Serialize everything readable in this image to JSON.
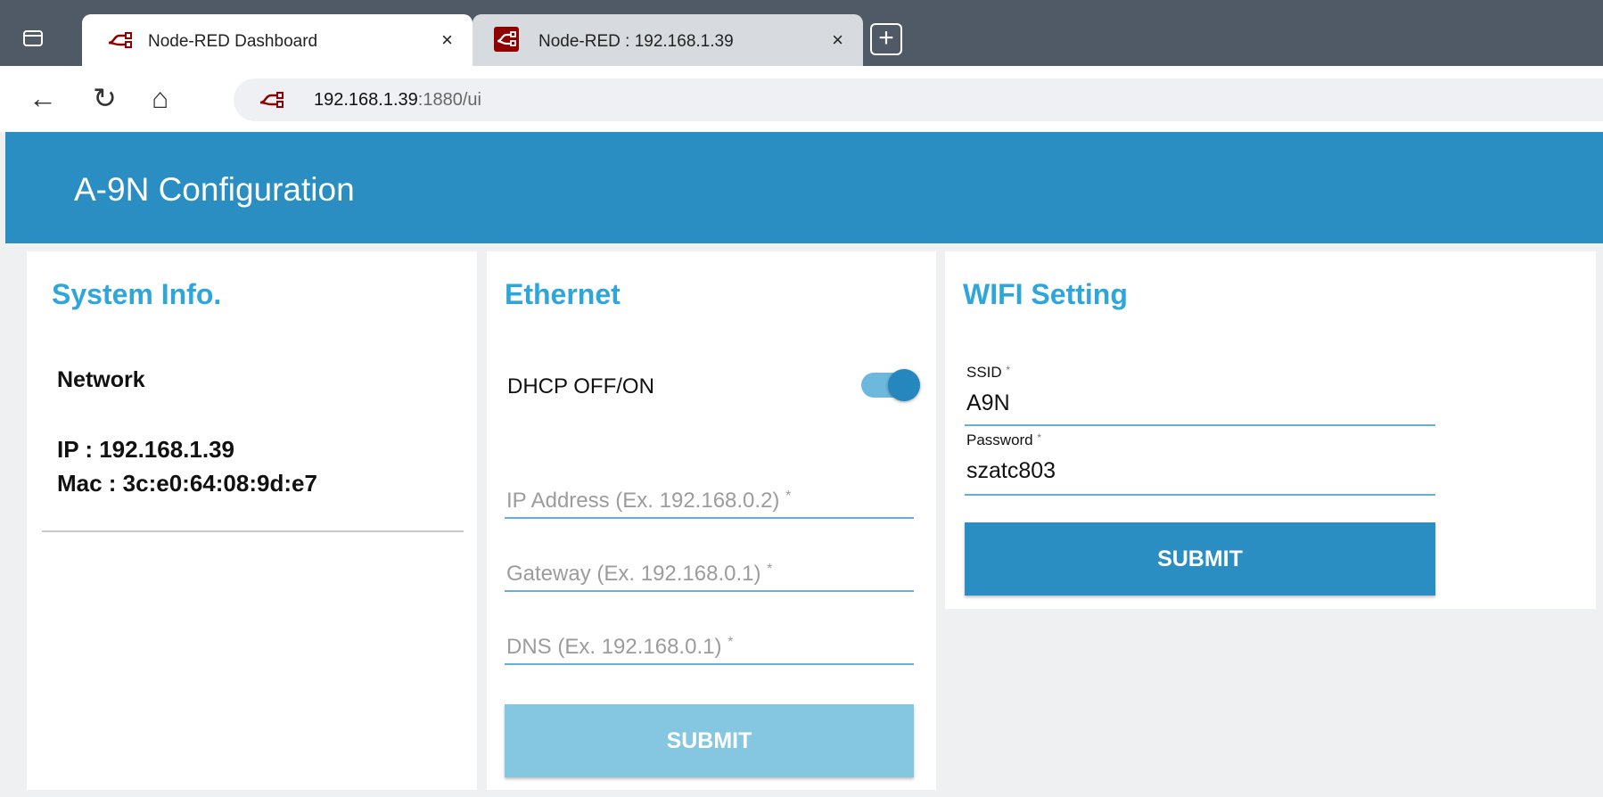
{
  "browser": {
    "tabs": [
      {
        "title": "Node-RED Dashboard",
        "active": true
      },
      {
        "title": "Node-RED : 192.168.1.39",
        "active": false
      }
    ],
    "tab_close_glyph": "×",
    "new_tab_glyph": "+",
    "nav": {
      "back_glyph": "←",
      "reload_glyph": "↻",
      "home_glyph": "⌂"
    },
    "url": {
      "host": "192.168.1.39",
      "rest": ":1880/ui"
    }
  },
  "dashboard": {
    "title": "A-9N Configuration",
    "accent_color": "#2b8ec3"
  },
  "system_info": {
    "title": "System Info.",
    "network_label": "Network",
    "ip_line": "IP :  192.168.1.39",
    "mac_line": "Mac :  3c:e0:64:08:9d:e7"
  },
  "ethernet": {
    "title": "Ethernet",
    "dhcp_label": "DHCP OFF/ON",
    "dhcp_on": true,
    "ip_placeholder": "IP Address (Ex. 192.168.0.2)",
    "gateway_placeholder": "Gateway (Ex. 192.168.0.1)",
    "dns_placeholder": "DNS (Ex. 192.168.0.1)",
    "required_mark": "*",
    "submit_label": "SUBMIT"
  },
  "wifi": {
    "title": "WIFI Setting",
    "ssid_label": "SSID",
    "ssid_value": "A9N",
    "password_label": "Password",
    "password_value": "szatc803",
    "required_mark": "*",
    "submit_label": "SUBMIT"
  }
}
